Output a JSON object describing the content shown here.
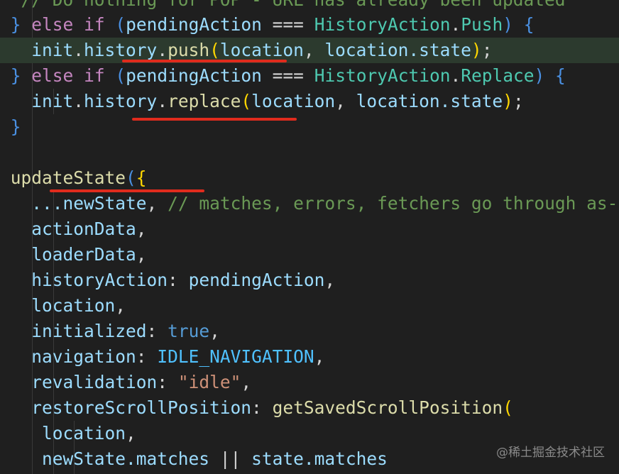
{
  "colors": {
    "background": "#1f1f1f",
    "current_line": "#2c3a2e",
    "keyword": "#c586c0",
    "type": "#4ec9b0",
    "function": "#dcdcaa",
    "variable": "#9cdcfe",
    "constant": "#4fc1ff",
    "boolean": "#569cd6",
    "string": "#ce9178",
    "comment": "#6a9955",
    "annotation_underline": "#e02b1d"
  },
  "code": {
    "l0_comment": "// Do nothing for POP - URL has already been updated",
    "l1_brace": "}",
    "l1_else": "else",
    "l1_if": "if",
    "l1_open": "(",
    "l1_var": "pendingAction",
    "l1_op": "===",
    "l1_type": "HistoryAction",
    "l1_dot": ".",
    "l1_member": "Push",
    "l1_close": ")",
    "l1_block": "{",
    "l2_obj": "init",
    "l2_dot1": ".",
    "l2_prop": "history",
    "l2_dot2": ".",
    "l2_fn": "push",
    "l2_open": "(",
    "l2_arg1": "location",
    "l2_comma": ",",
    "l2_arg2": "location.state",
    "l2_close": ")",
    "l2_semi": ";",
    "l3_brace": "}",
    "l3_else": "else",
    "l3_if": "if",
    "l3_open": "(",
    "l3_var": "pendingAction",
    "l3_op": "===",
    "l3_type": "HistoryAction",
    "l3_dot": ".",
    "l3_member": "Replace",
    "l3_close": ")",
    "l3_block": "{",
    "l4_obj": "init",
    "l4_dot1": ".",
    "l4_prop": "history",
    "l4_dot2": ".",
    "l4_fn": "replace",
    "l4_open": "(",
    "l4_arg1": "location",
    "l4_comma": ",",
    "l4_arg2": "location.state",
    "l4_close": ")",
    "l4_semi": ";",
    "l5_brace": "}",
    "l7_fn": "updateState",
    "l7_paren": "(",
    "l7_brace": "{",
    "l8_spread": "...newState",
    "l8_comma": ",",
    "l8_comment": "// matches, errors, fetchers go through as-is",
    "l9_key": "actionData",
    "l9_comma": ",",
    "l10_key": "loaderData",
    "l10_comma": ",",
    "l11_key": "historyAction",
    "l11_colon": ":",
    "l11_val": "pendingAction",
    "l11_comma": ",",
    "l12_key": "location",
    "l12_comma": ",",
    "l13_key": "initialized",
    "l13_colon": ":",
    "l13_val": "true",
    "l13_comma": ",",
    "l14_key": "navigation",
    "l14_colon": ":",
    "l14_val": "IDLE_NAVIGATION",
    "l14_comma": ",",
    "l15_key": "revalidation",
    "l15_colon": ":",
    "l15_val": "\"idle\"",
    "l15_comma": ",",
    "l16_key": "restoreScrollPosition",
    "l16_colon": ":",
    "l16_fn": "getSavedScrollPosition",
    "l16_paren": "(",
    "l17_arg": "location",
    "l17_comma": ",",
    "l18_arg1": "newState.matches",
    "l18_op": "||",
    "l18_arg2": "state.matches"
  },
  "watermark": "@稀土掘金技术社区"
}
